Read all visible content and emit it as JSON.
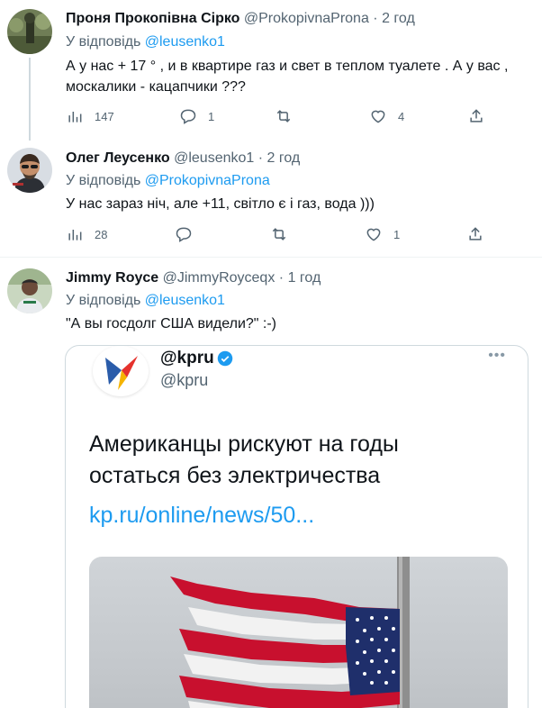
{
  "tweets": [
    {
      "name": "Проня Прокопівна Сірко",
      "handle": "@ProkopivnaProna",
      "dot": "·",
      "time": "2 год",
      "reply_prefix": "У відповідь",
      "reply_mention": "@leusenko1",
      "text_lines": [
        "А у нас + 17 ° , и в квартире газ и свет в теплом туалете . А у вас ,",
        "москалики - кацапчики ???"
      ],
      "views": "147",
      "replies": "1",
      "retweets": "",
      "likes": "4"
    },
    {
      "name": "Олег Леусенко",
      "handle": "@leusenko1",
      "dot": "·",
      "time": "2 год",
      "reply_prefix": "У відповідь",
      "reply_mention": "@ProkopivnaProna",
      "text_lines": [
        "У нас зараз ніч, але +11, світло є і газ, вода )))"
      ],
      "views": "28",
      "replies": "",
      "retweets": "",
      "likes": "1"
    },
    {
      "name": "Jimmy Royce",
      "handle": "@JimmyRoyceqx",
      "dot": "·",
      "time": "1 год",
      "reply_prefix": "У відповідь",
      "reply_mention": "@leusenko1",
      "text_lines": [
        "\"А вы госдолг США видели?\" :-)"
      ]
    }
  ],
  "embedded_card": {
    "account_name": "@kpru",
    "account_handle": "@kpru",
    "more": "•••",
    "headline_lines": [
      "Американцы рискуют на годы",
      "остаться без электричества"
    ],
    "link": "kp.ru/online/news/50..."
  },
  "colors": {
    "link": "#1d9bf0",
    "secondary_text": "#536471",
    "divider": "#eff3f4",
    "kp_red": "#e5322d",
    "kp_blue": "#2a5caa",
    "kp_yellow": "#f5b400"
  },
  "icons": [
    "views-icon",
    "reply-icon",
    "retweet-icon",
    "like-icon",
    "share-icon",
    "verified-icon"
  ]
}
